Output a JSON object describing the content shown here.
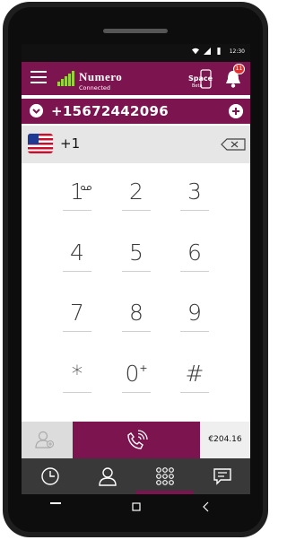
{
  "status_bar": {
    "time": "12:30"
  },
  "header": {
    "logo_text": "Numero",
    "connection_status": "Connected",
    "space_label": "Space",
    "space_beta": "Beta",
    "notification_count": "11"
  },
  "dial": {
    "number": "+15672442096",
    "country_code": "+1"
  },
  "keypad": {
    "keys": [
      "1",
      "2",
      "3",
      "4",
      "5",
      "6",
      "7",
      "8",
      "9",
      "*",
      "0",
      "#"
    ],
    "zero_sub": "+"
  },
  "actions": {
    "balance": "€204.16"
  },
  "colors": {
    "brand": "#7c154f",
    "nav_bg": "#393939",
    "signal": "#9cd03c",
    "badge": "#e03131"
  },
  "icons": {
    "menu": "hamburger-icon",
    "signal": "signal-bars-icon",
    "bell": "bell-icon",
    "chevron": "chevron-down-icon",
    "add": "plus-icon",
    "backspace": "backspace-icon",
    "contact_add": "contact-add-icon",
    "call": "wifi-call-icon",
    "nav": [
      "clock-icon",
      "contact-icon",
      "dialpad-icon",
      "chat-icon"
    ]
  }
}
